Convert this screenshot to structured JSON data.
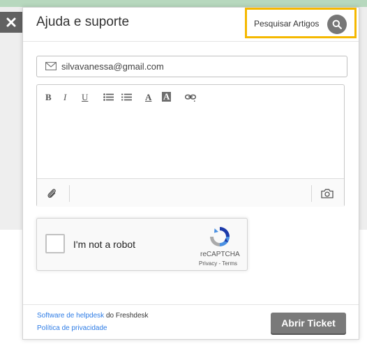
{
  "close": {
    "icon": "close-icon"
  },
  "header": {
    "title": "Ajuda e suporte"
  },
  "search": {
    "label": "Pesquisar Artigos",
    "icon": "search-icon",
    "highlight_color": "#f5b800"
  },
  "form": {
    "email_value": "silvavanessa@gmail.com",
    "email_icon": "envelope-icon",
    "toolbar": {
      "bold": "B",
      "italic": "I",
      "underline": "U",
      "font_color": "A",
      "bg_color": "A"
    },
    "attach_icon": "paperclip-icon",
    "camera_icon": "camera-icon"
  },
  "recaptcha": {
    "label": "I'm not a robot",
    "brand": "reCAPTCHA",
    "privacy": "Privacy",
    "sep": " - ",
    "terms": "Terms"
  },
  "footer": {
    "link1": "Software de helpdesk",
    "text1": " do Freshdesk",
    "link2": "Política de privacidade",
    "submit": "Abrir Ticket"
  }
}
